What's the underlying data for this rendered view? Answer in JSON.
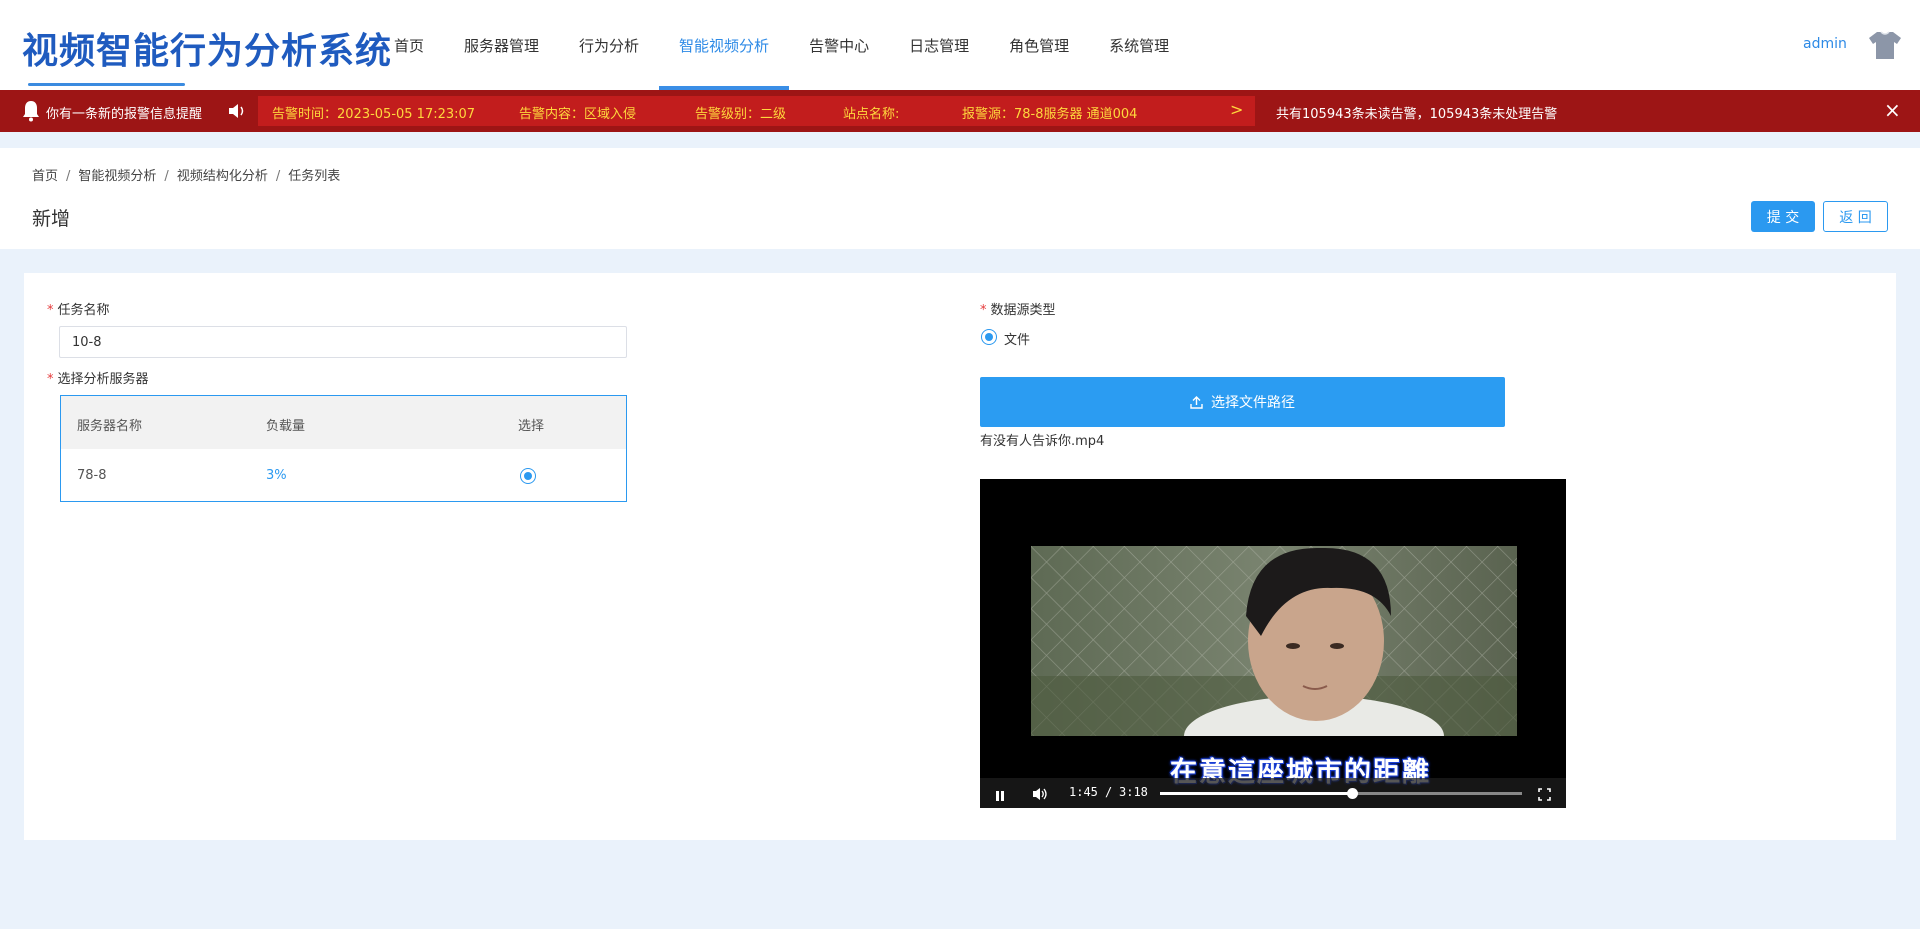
{
  "app": {
    "title": "视频智能行为分析系统",
    "user": "admin"
  },
  "nav": [
    {
      "label": "首页"
    },
    {
      "label": "服务器管理"
    },
    {
      "label": "行为分析"
    },
    {
      "label": "智能视频分析",
      "active": true
    },
    {
      "label": "告警中心"
    },
    {
      "label": "日志管理"
    },
    {
      "label": "角色管理"
    },
    {
      "label": "系统管理"
    }
  ],
  "alarm": {
    "title": "你有一条新的报警信息提醒",
    "time": "告警时间：2023-05-05 17:23:07",
    "content": "告警内容：区域入侵",
    "level": "告警级别：二级",
    "site": "站点名称:",
    "source": "报警源：78-8服务器 通道004",
    "summary": "共有105943条未读告警，105943条未处理告警",
    "close": "×",
    "next": ">"
  },
  "breadcrumb": [
    "首页",
    "智能视频分析",
    "视频结构化分析",
    "任务列表"
  ],
  "page": {
    "title": "新增",
    "submit": "提 交",
    "back": "返 回"
  },
  "form": {
    "task_name_label": "任务名称",
    "task_name_value": "10-8",
    "server_label": "选择分析服务器",
    "table": {
      "headers": [
        "服务器名称",
        "负载量",
        "选择"
      ],
      "rows": [
        {
          "name": "78-8",
          "load": "3%",
          "selected": true
        }
      ]
    },
    "source_type_label": "数据源类型",
    "source_option": "文件",
    "upload_label": "选择文件路径",
    "filename": "有没有人告诉你.mp4"
  },
  "video": {
    "current": "1:45",
    "sep": "/",
    "duration": "3:18",
    "progress": 0.53,
    "subtitle": "在意這座城市的距離"
  },
  "colors": {
    "brand": "#1f5bbf",
    "accent": "#2b99f0",
    "alarm_bg": "#9d1515",
    "alarm_text": "#ffd83d"
  }
}
